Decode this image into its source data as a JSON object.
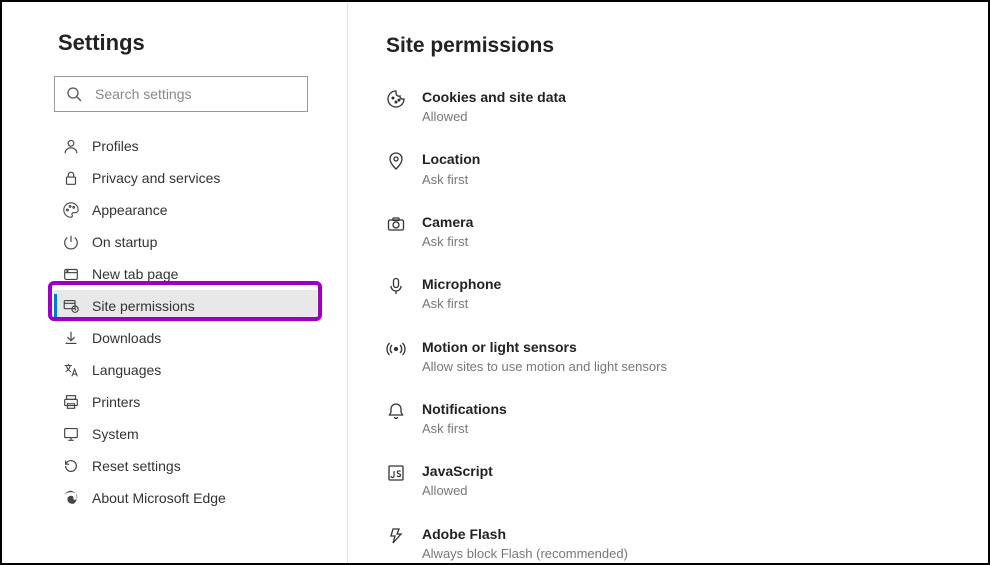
{
  "sidebar": {
    "title": "Settings",
    "search_placeholder": "Search settings",
    "items": [
      {
        "label": "Profiles"
      },
      {
        "label": "Privacy and services"
      },
      {
        "label": "Appearance"
      },
      {
        "label": "On startup"
      },
      {
        "label": "New tab page"
      },
      {
        "label": "Site permissions"
      },
      {
        "label": "Downloads"
      },
      {
        "label": "Languages"
      },
      {
        "label": "Printers"
      },
      {
        "label": "System"
      },
      {
        "label": "Reset settings"
      },
      {
        "label": "About Microsoft Edge"
      }
    ]
  },
  "main": {
    "title": "Site permissions",
    "permissions": [
      {
        "title": "Cookies and site data",
        "sub": "Allowed"
      },
      {
        "title": "Location",
        "sub": "Ask first"
      },
      {
        "title": "Camera",
        "sub": "Ask first"
      },
      {
        "title": "Microphone",
        "sub": "Ask first"
      },
      {
        "title": "Motion or light sensors",
        "sub": "Allow sites to use motion and light sensors"
      },
      {
        "title": "Notifications",
        "sub": "Ask first"
      },
      {
        "title": "JavaScript",
        "sub": "Allowed"
      },
      {
        "title": "Adobe Flash",
        "sub": "Always block Flash (recommended)"
      }
    ]
  }
}
